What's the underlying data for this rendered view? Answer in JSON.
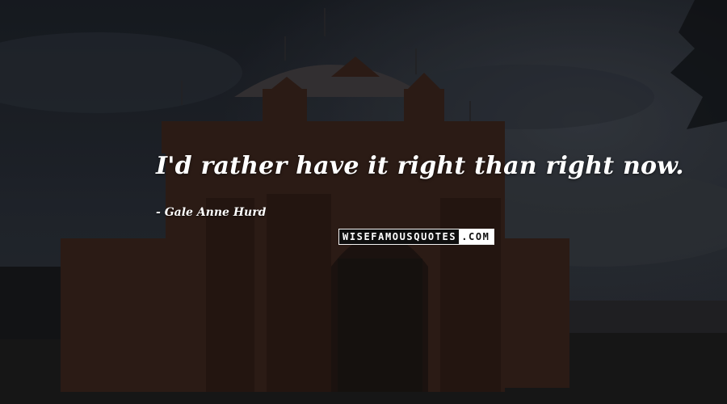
{
  "quote": {
    "text": "I'd rather have it right than right now.",
    "author": "Gale Anne Hurd"
  },
  "watermark": {
    "dark_part": "WISEFAMOUSQUOTES",
    "light_part": ".COM"
  },
  "colors": {
    "text": "#ffffff",
    "sky_dark": "#14171c",
    "brick": "#3a2218"
  }
}
